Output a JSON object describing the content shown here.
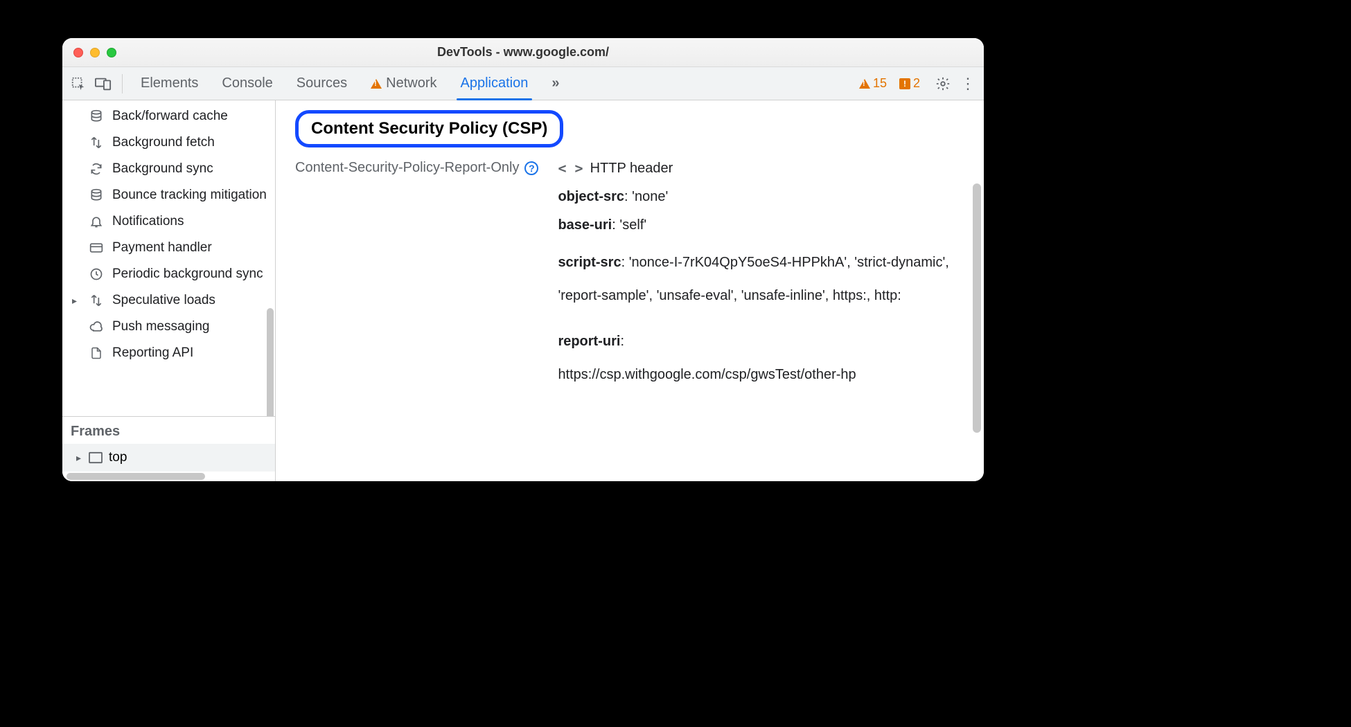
{
  "window": {
    "title": "DevTools - www.google.com/"
  },
  "toolbar": {
    "tabs": [
      "Elements",
      "Console",
      "Sources",
      "Network",
      "Application"
    ],
    "active_tab": "Application",
    "more_label": "»",
    "warning_count": "15",
    "issue_count": "2"
  },
  "sidebar": {
    "items": [
      {
        "icon": "database-icon",
        "label": "Back/forward cache"
      },
      {
        "icon": "up-down-arrows-icon",
        "label": "Background fetch"
      },
      {
        "icon": "sync-icon",
        "label": "Background sync"
      },
      {
        "icon": "database-icon",
        "label": "Bounce tracking mitigation"
      },
      {
        "icon": "bell-icon",
        "label": "Notifications"
      },
      {
        "icon": "card-icon",
        "label": "Payment handler"
      },
      {
        "icon": "clock-icon",
        "label": "Periodic background sync"
      },
      {
        "icon": "up-down-arrows-icon",
        "label": "Speculative loads",
        "has_children": true
      },
      {
        "icon": "cloud-icon",
        "label": "Push messaging"
      },
      {
        "icon": "file-icon",
        "label": "Reporting API"
      }
    ],
    "frames_heading": "Frames",
    "frames": {
      "label": "top"
    }
  },
  "main": {
    "heading": "Content Security Policy (CSP)",
    "policy_header_label": "Content-Security-Policy-Report-Only",
    "source_label": "HTTP header",
    "directives": [
      {
        "name": "object-src",
        "value": "'none'"
      },
      {
        "name": "base-uri",
        "value": "'self'"
      },
      {
        "name": "script-src",
        "value": "'nonce-I-7rK04QpY5oeS4-HPPkhA', 'strict-dynamic', 'report-sample', 'unsafe-eval', 'unsafe-inline', https:, http:"
      },
      {
        "name": "report-uri",
        "value": "https://csp.withgoogle.com/csp/gwsTest/other-hp"
      }
    ]
  }
}
